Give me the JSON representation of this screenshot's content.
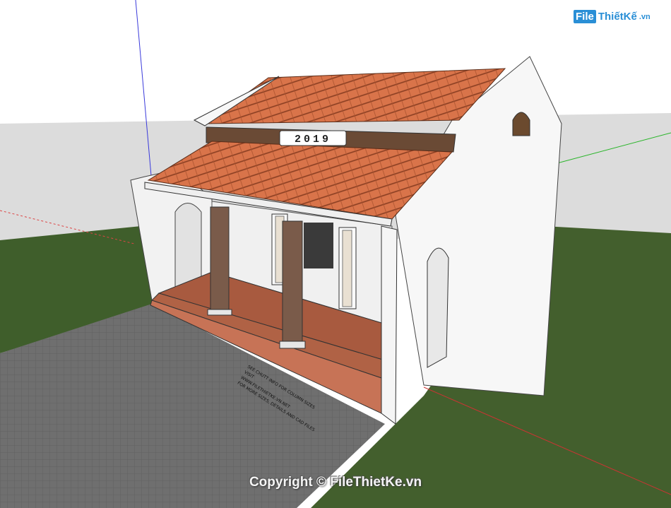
{
  "watermark": {
    "box": "File",
    "name": "ThiếtKế",
    "domain": ".vn"
  },
  "year_plaque": "2019",
  "ground_note": {
    "line1": "SEE CHUTT INFO FOR COLUMN SIZES",
    "line2": "VISIT",
    "line3": "WWW.FILETHIETKE.VN.NET",
    "line4": "FOR MORE SIZES, DETAILS AND CAD FILES"
  },
  "copyright": "Copyright © FileThietKe.vn",
  "colors": {
    "roof": "#d9744a",
    "wall": "#ffffff",
    "grass": "#3f5e2b",
    "paving": "#6d6d6d",
    "floor": "#a85a3f",
    "column": "#7a5b4a"
  }
}
